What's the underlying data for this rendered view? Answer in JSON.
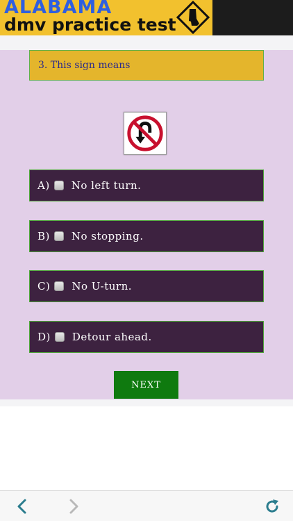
{
  "banner": {
    "title": "ALABAMA",
    "subtitle": "dmv practice test"
  },
  "question": {
    "text": "3. This sign means"
  },
  "options": [
    {
      "letter": "A)",
      "text": "No left turn."
    },
    {
      "letter": "B)",
      "text": "No stopping."
    },
    {
      "letter": "C)",
      "text": "No U-turn."
    },
    {
      "letter": "D)",
      "text": "Detour ahead."
    }
  ],
  "next_label": "NEXT",
  "toolbar": {
    "back_icon": "chevron-left-icon",
    "forward_icon": "chevron-right-icon",
    "reload_icon": "reload-icon"
  },
  "colors": {
    "banner_yellow": "#f2c12e",
    "banner_blue": "#2f5fe0",
    "panel_bg": "#e2cfe8",
    "question_bg": "#e4b52c",
    "option_bg": "#3d2240",
    "option_border": "#4fa63a",
    "next_bg": "#0f7a0f",
    "toolbar_accent": "#2b7d8e"
  }
}
